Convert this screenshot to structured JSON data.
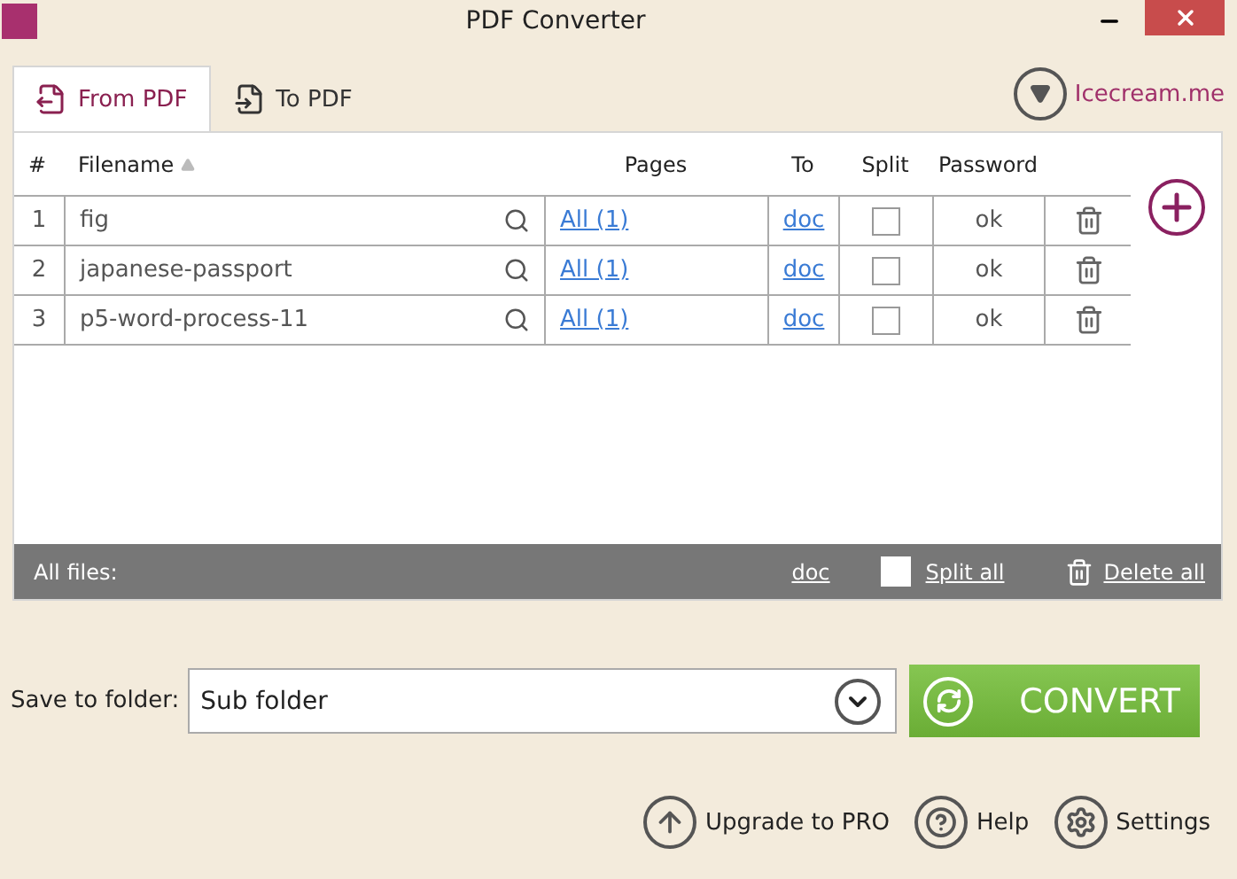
{
  "window": {
    "title": "PDF Converter"
  },
  "tabs": [
    {
      "label": "From PDF",
      "selected": true
    },
    {
      "label": "To PDF",
      "selected": false
    }
  ],
  "brand_link": "Icecream.me",
  "table": {
    "columns": [
      {
        "label": "#",
        "sorted": false
      },
      {
        "label": "Filename",
        "sorted": true
      },
      {
        "label": "Pages",
        "sorted": false
      },
      {
        "label": "To",
        "sorted": false
      },
      {
        "label": "Split",
        "sorted": false
      },
      {
        "label": "Password",
        "sorted": false
      }
    ],
    "rows": [
      {
        "index": "1",
        "filename": "fig",
        "pages": "All (1)",
        "to": "doc",
        "split": false,
        "password": "ok"
      },
      {
        "index": "2",
        "filename": "japanese-passport",
        "pages": "All (1)",
        "to": "doc",
        "split": false,
        "password": "ok"
      },
      {
        "index": "3",
        "filename": "p5-word-process-11",
        "pages": "All (1)",
        "to": "doc",
        "split": false,
        "password": "ok"
      }
    ]
  },
  "footer": {
    "label": "All files:",
    "to": "doc",
    "split_all": {
      "label": "Split all",
      "checked": false
    },
    "delete_all": "Delete all"
  },
  "save": {
    "label": "Save to folder:",
    "value": "Sub folder"
  },
  "convert_button": "CONVERT",
  "bottom_links": [
    "Upgrade to PRO",
    "Help",
    "Settings"
  ]
}
